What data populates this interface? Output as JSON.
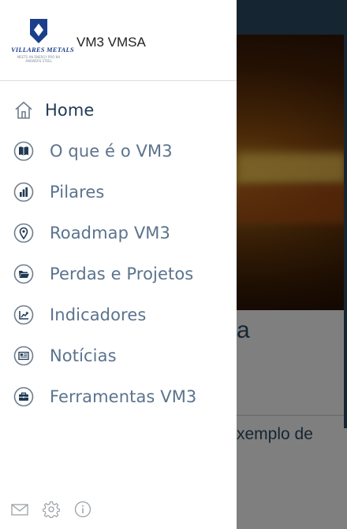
{
  "background": {
    "title_fragment": "a",
    "body_fragment": "xemplo de"
  },
  "drawer": {
    "app_name": "VM3 VMSA",
    "logo": {
      "name": "VILLARES METALS",
      "tagline": "MEETS AN ENERGY PRO NA ANSWERS STEEL"
    },
    "menu": [
      {
        "label": "Home",
        "icon": "home-icon"
      },
      {
        "label": "O que é o VM3",
        "icon": "book-icon"
      },
      {
        "label": "Pilares",
        "icon": "bar-chart-icon"
      },
      {
        "label": "Roadmap VM3",
        "icon": "map-pin-icon"
      },
      {
        "label": "Perdas e Projetos",
        "icon": "folder-icon"
      },
      {
        "label": "Indicadores",
        "icon": "trend-chart-icon"
      },
      {
        "label": "Notícias",
        "icon": "newspaper-icon"
      },
      {
        "label": "Ferramentas VM3",
        "icon": "briefcase-icon"
      }
    ],
    "footer": [
      "mail-icon",
      "gear-icon",
      "info-icon"
    ]
  },
  "colors": {
    "brand_blue": "#1c3f8c",
    "topbar": "#2c4a64",
    "menu_text": "#5b738d",
    "home_text": "#1f3a55"
  }
}
